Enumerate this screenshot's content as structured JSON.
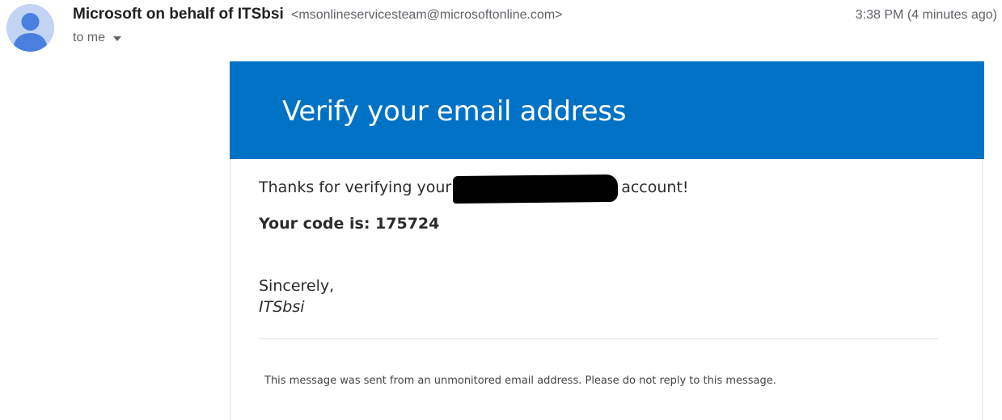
{
  "sender": {
    "name": "Microsoft on behalf of ITSbsi",
    "email": "<msonlineservicesteam@microsoftonline.com>",
    "avatar_icon": "person-avatar-icon"
  },
  "timestamp": "3:38 PM (4 minutes ago)",
  "recipient": {
    "label": "to me",
    "dropdown_icon": "caret-down-icon"
  },
  "email": {
    "banner_title": "Verify your email address",
    "banner_color": "#0072c6",
    "thanks_prefix": "Thanks for verifying your",
    "thanks_suffix": "account!",
    "code_line": "Your code is: 175724",
    "sign_off": "Sincerely,",
    "signature": "ITSbsi",
    "footer_note": "This message was sent from an unmonitored email address. Please do not reply to this message."
  }
}
